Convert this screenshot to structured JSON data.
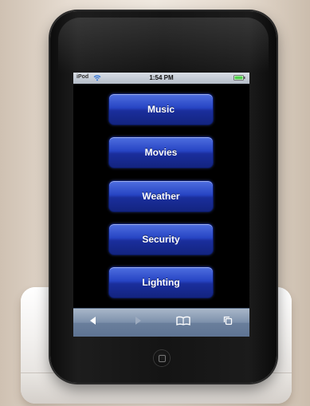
{
  "status_bar": {
    "carrier": "iPod",
    "time": "1:54 PM"
  },
  "menu": {
    "items": [
      {
        "label": "Music"
      },
      {
        "label": "Movies"
      },
      {
        "label": "Weather"
      },
      {
        "label": "Security"
      },
      {
        "label": "Lighting"
      }
    ]
  },
  "toolbar": {
    "buttons": [
      {
        "icon": "back-arrow-icon",
        "enabled": true
      },
      {
        "icon": "forward-arrow-icon",
        "enabled": false
      },
      {
        "icon": "bookmarks-icon",
        "enabled": true
      },
      {
        "icon": "pages-icon",
        "enabled": true
      }
    ]
  },
  "colors": {
    "button_blue": "#2745c4",
    "toolbar": "#7c90ab",
    "status_bar": "#c4cbd5",
    "battery_green": "#4fd14a"
  }
}
